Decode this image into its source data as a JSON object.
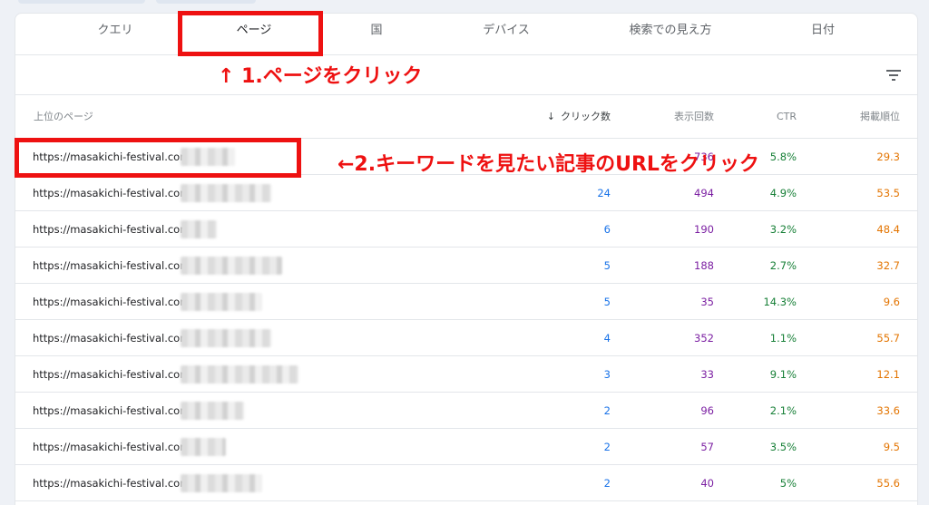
{
  "tabs": [
    {
      "label": "クエリ",
      "active": false
    },
    {
      "label": "ページ",
      "active": true
    },
    {
      "label": "国",
      "active": false
    },
    {
      "label": "デバイス",
      "active": false
    },
    {
      "label": "検索での見え方",
      "active": false
    },
    {
      "label": "日付",
      "active": false
    }
  ],
  "toolbar": {
    "filter_icon": "filter-icon"
  },
  "table": {
    "headers": {
      "page": "上位のページ",
      "clicks": "クリック数",
      "impressions": "表示回数",
      "ctr": "CTR",
      "position": "掲載順位"
    },
    "sort_icon": "arrow-down-icon",
    "rows": [
      {
        "url": "https://masakichi-festival.com/",
        "clicks": "",
        "impressions": "736",
        "ctr": "5.8%",
        "position": "29.3"
      },
      {
        "url": "https://masakichi-festival.com/",
        "clicks": "24",
        "impressions": "494",
        "ctr": "4.9%",
        "position": "53.5"
      },
      {
        "url": "https://masakichi-festival.com/",
        "clicks": "6",
        "impressions": "190",
        "ctr": "3.2%",
        "position": "48.4"
      },
      {
        "url": "https://masakichi-festival.com/",
        "clicks": "5",
        "impressions": "188",
        "ctr": "2.7%",
        "position": "32.7"
      },
      {
        "url": "https://masakichi-festival.com/",
        "clicks": "5",
        "impressions": "35",
        "ctr": "14.3%",
        "position": "9.6"
      },
      {
        "url": "https://masakichi-festival.com/",
        "clicks": "4",
        "impressions": "352",
        "ctr": "1.1%",
        "position": "55.7"
      },
      {
        "url": "https://masakichi-festival.com/",
        "clicks": "3",
        "impressions": "33",
        "ctr": "9.1%",
        "position": "12.1"
      },
      {
        "url": "https://masakichi-festival.com/",
        "clicks": "2",
        "impressions": "96",
        "ctr": "2.1%",
        "position": "33.6"
      },
      {
        "url": "https://masakichi-festival.com/",
        "clicks": "2",
        "impressions": "57",
        "ctr": "3.5%",
        "position": "9.5"
      },
      {
        "url": "https://masakichi-festival.com/",
        "clicks": "2",
        "impressions": "40",
        "ctr": "5%",
        "position": "55.6"
      }
    ]
  },
  "annotations": {
    "step1": "↑ 1.ページをクリック",
    "step2": "←2.キーワードを見たい記事のURLをクリック",
    "color": "#ee1111"
  },
  "colors": {
    "clicks": "#1a73e8",
    "impressions": "#7b1fa2",
    "ctr": "#188038",
    "position": "#e37400"
  }
}
